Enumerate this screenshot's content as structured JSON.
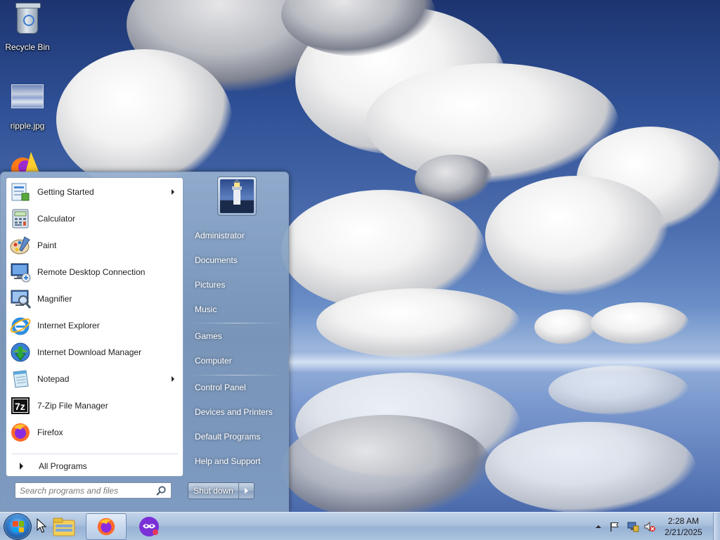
{
  "desktop": {
    "icons": [
      {
        "label": "Recycle Bin",
        "icon": "recycle-bin-icon"
      },
      {
        "label": "ripple.jpg",
        "icon": "image-file-icon"
      },
      {
        "label": "",
        "icon": "firefox-shortcut-icon"
      }
    ]
  },
  "start_menu": {
    "programs": [
      {
        "label": "Getting Started",
        "icon": "getting-started-icon",
        "has_submenu": true
      },
      {
        "label": "Calculator",
        "icon": "calculator-icon",
        "has_submenu": false
      },
      {
        "label": "Paint",
        "icon": "paint-icon",
        "has_submenu": false
      },
      {
        "label": "Remote Desktop Connection",
        "icon": "remote-desktop-icon",
        "has_submenu": false
      },
      {
        "label": "Magnifier",
        "icon": "magnifier-icon",
        "has_submenu": false
      },
      {
        "label": "Internet Explorer",
        "icon": "internet-explorer-icon",
        "has_submenu": false
      },
      {
        "label": "Internet Download Manager",
        "icon": "download-manager-icon",
        "has_submenu": false
      },
      {
        "label": "Notepad",
        "icon": "notepad-icon",
        "has_submenu": true
      },
      {
        "label": "7-Zip File Manager",
        "icon": "7zip-icon",
        "has_submenu": false
      },
      {
        "label": "Firefox",
        "icon": "firefox-icon",
        "has_submenu": false
      }
    ],
    "all_programs_label": "All Programs",
    "search_placeholder": "Search programs and files",
    "right_items": [
      "Administrator",
      "Documents",
      "Pictures",
      "Music",
      "Games",
      "Computer",
      "Control Panel",
      "Devices and Printers",
      "Default Programs",
      "Help and Support"
    ],
    "shutdown_label": "Shut down"
  },
  "taskbar": {
    "pinned": [
      "windows-explorer-icon",
      "firefox-icon",
      "vpn-app-icon"
    ],
    "tray_icons": [
      "show-hidden-icons-arrow",
      "action-center-flag-icon",
      "network-icon",
      "volume-muted-icon"
    ],
    "clock_time": "2:28 AM",
    "clock_date": "2/21/2025"
  },
  "colors": {
    "taskbar": "#a9c0dd",
    "start_orb": "#2f7fd0",
    "menu_text_dark": "#1e1e1e",
    "menu_text_light": "#ffffff"
  }
}
